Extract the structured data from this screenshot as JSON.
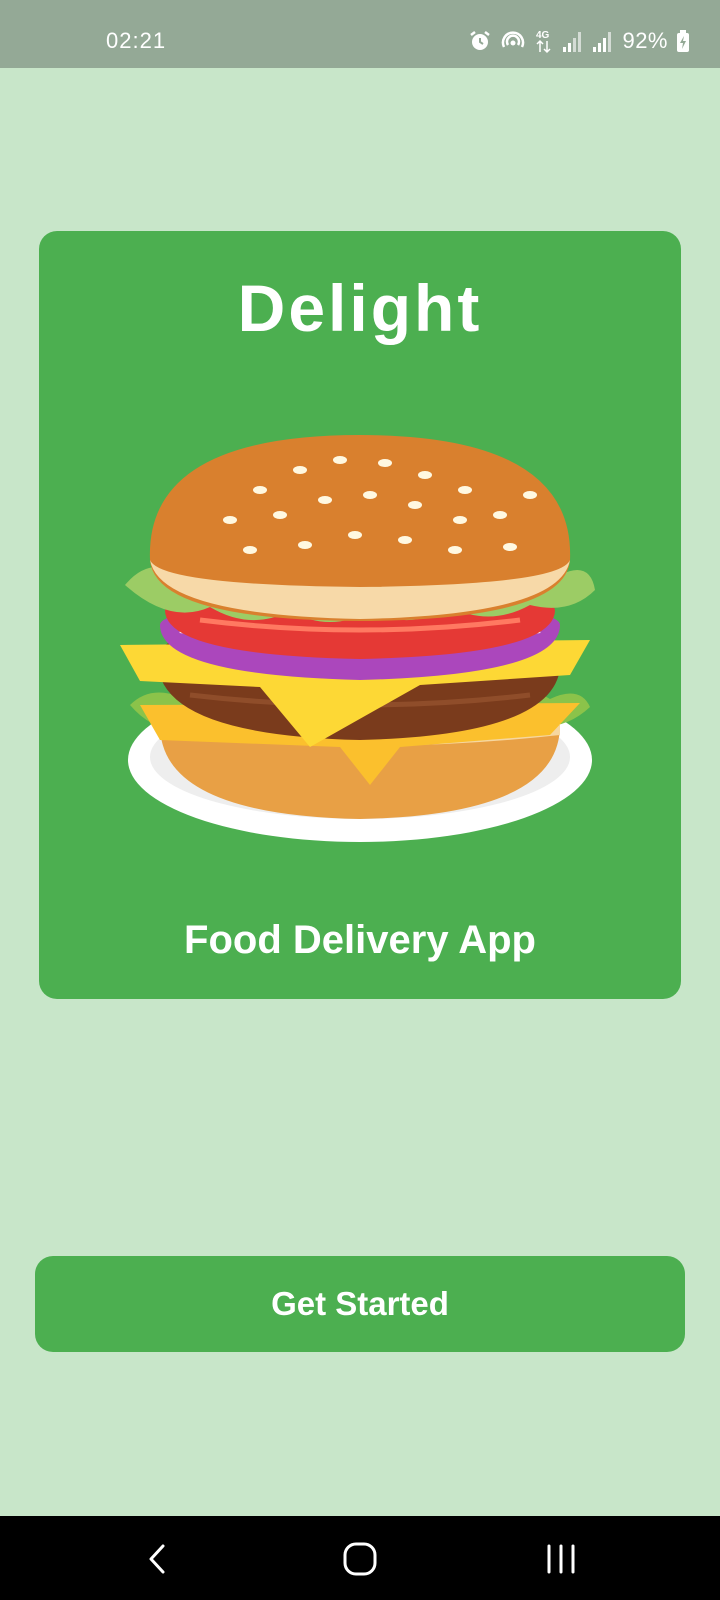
{
  "status_bar": {
    "time": "02:21",
    "network": "4G",
    "battery": "92%",
    "icons": [
      "alarm-icon",
      "hotspot-icon",
      "4g-icon",
      "signal-icon",
      "signal-icon",
      "battery-charging-icon"
    ]
  },
  "splash": {
    "title": "Delight",
    "image": "burger-illustration",
    "subtitle": "Food Delivery App"
  },
  "actions": {
    "get_started_label": "Get Started"
  },
  "nav_bar": {
    "icons": [
      "back-icon",
      "home-icon",
      "recents-icon"
    ]
  },
  "colors": {
    "background": "#c8e6c9",
    "accent": "#4caf50",
    "status_bar": "#94a996",
    "nav_bar": "#000000"
  }
}
